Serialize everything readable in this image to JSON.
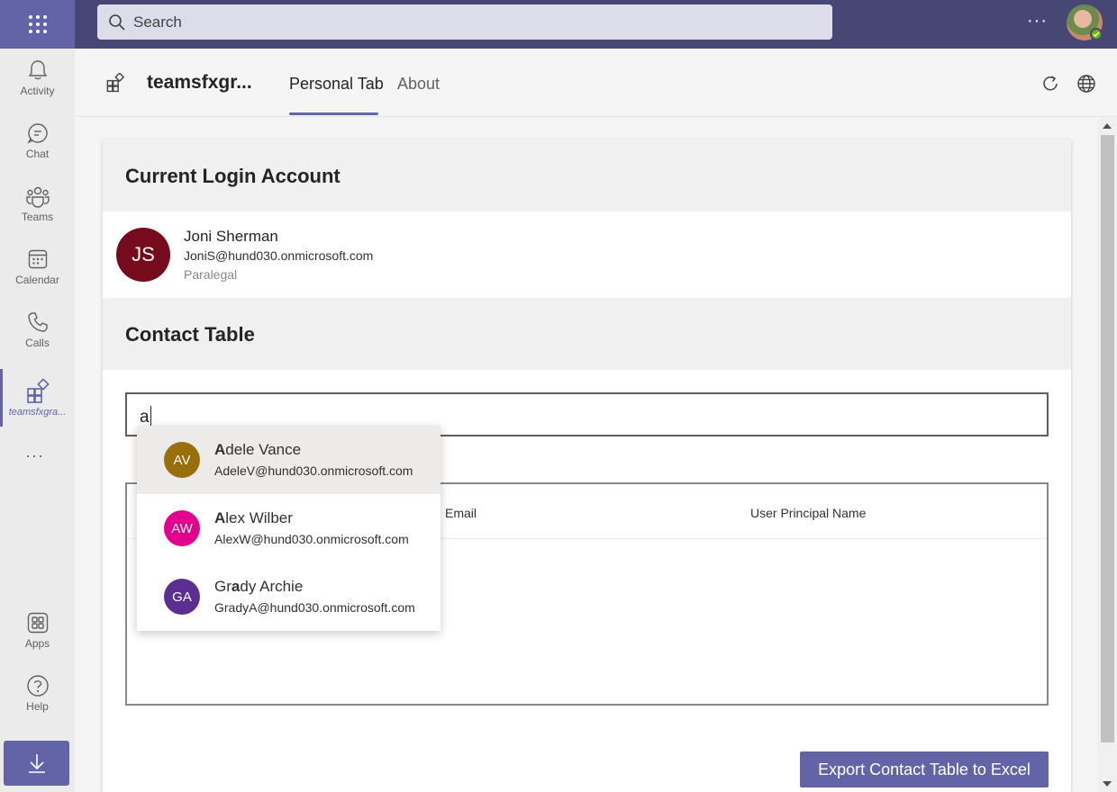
{
  "topbar": {
    "search_placeholder": "Search",
    "more_label": "···"
  },
  "rail": {
    "items": [
      {
        "label": "Activity",
        "icon": "bell-icon"
      },
      {
        "label": "Chat",
        "icon": "chat-icon"
      },
      {
        "label": "Teams",
        "icon": "teams-icon"
      },
      {
        "label": "Calendar",
        "icon": "calendar-icon"
      },
      {
        "label": "Calls",
        "icon": "phone-icon"
      },
      {
        "label": "teamsfxgra...",
        "icon": "app-icon",
        "active": true
      },
      {
        "label": "Apps",
        "icon": "apps-icon"
      },
      {
        "label": "Help",
        "icon": "help-icon"
      }
    ],
    "more_label": "···",
    "download_icon": "download-icon"
  },
  "header": {
    "app_name": "teamsfxgr...",
    "tabs": [
      {
        "label": "Personal Tab",
        "selected": true
      },
      {
        "label": "About",
        "selected": false
      }
    ]
  },
  "login": {
    "section_title": "Current Login Account",
    "initials": "JS",
    "name": "Joni Sherman",
    "email": "JoniS@hund030.onmicrosoft.com",
    "job_title": "Paralegal",
    "avatar_color": "#750b1c"
  },
  "contacts": {
    "section_title": "Contact Table",
    "picker_value": "a",
    "columns": [
      "Email",
      "User Principal Name"
    ],
    "suggestions": [
      {
        "initials": "AV",
        "name_pre": "",
        "name_match": "A",
        "name_post": "dele Vance",
        "email": "AdeleV@hund030.onmicrosoft.com",
        "color": "#986f0b"
      },
      {
        "initials": "AW",
        "name_pre": "",
        "name_match": "A",
        "name_post": "lex Wilber",
        "email": "AlexW@hund030.onmicrosoft.com",
        "color": "#e3008c"
      },
      {
        "initials": "GA",
        "name_pre": "Gr",
        "name_match": "a",
        "name_post": "dy Archie",
        "email": "GradyA@hund030.onmicrosoft.com",
        "color": "#5c2e91"
      }
    ],
    "export_label": "Export Contact Table to Excel"
  },
  "colors": {
    "accent": "#6264a7",
    "topbar": "#464775"
  }
}
